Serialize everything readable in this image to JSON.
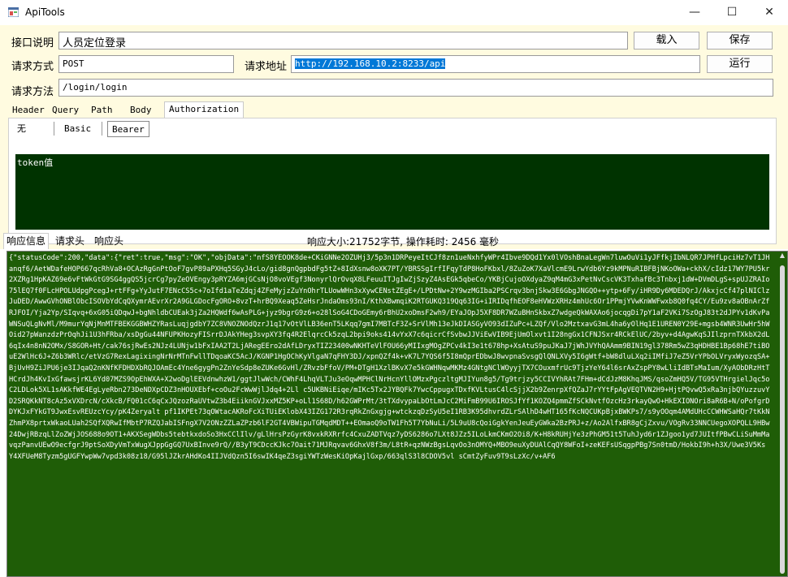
{
  "window": {
    "title": "ApiTools",
    "minimize": "—",
    "maximize": "☐",
    "close": "✕"
  },
  "form": {
    "desc_label": "接口说明",
    "desc_value": "人员定位登录",
    "method_label": "请求方式",
    "method_value": "POST",
    "url_label": "请求地址",
    "url_value": "http://192.168.10.2:8233/api",
    "path_label": "请求方法",
    "path_value": "/login/login",
    "load_button": "载入",
    "save_button": "保存",
    "run_button": "运行"
  },
  "request_tabs": [
    "Header",
    "Query",
    "Path",
    "Body",
    "Authorization"
  ],
  "auth_tabs": [
    "无",
    "Basic",
    "Bearer"
  ],
  "token_value": "token值",
  "response": {
    "tabs": [
      "响应信息",
      "请求头",
      "响应头"
    ],
    "info": "响应大小:21752字节, 操作耗时: 2456 毫秒",
    "body": "{\"statusCode\":200,\"data\":{\"ret\":true,\"msg\":\"OK\",\"objData\":\"nfS8YEOOK8de+CKiGNNe2OZUHj3/5p3n1DRPeyeItCJf8zn1ueNxhfyWPr4Ibve9DQd1Yx0lVOshBnaLegWn7luwOuVi1yJFfkjIbNLQR7JPHfLpciHz7vT1JHanqf6/AetWDafeHOP667qcRhVa8+OCAzRgGnPtOoF7gvP89aPXHq5SGyJ4cLo/gid8gnQgpbdFg5tZ+8IdXsnw8oXK7PT/YBRSSgIrfIFqyTdP8HoFKbxl/8ZuZoK7XaVlcmE9LrwYdb6Yz9kMPNuRIBFBjNKoOWa+ckhX/cIdz17WY7PU5kr2XZRg1HpKAZ69e6vFtWkGtG9SG4ggQS5jcrCg7pyZeOVEngy3pRYZA6mjGCsNjO8voVEgf3NonyrlQrOvqX8LFeuuITJgIwZjSzyZ4AsEGk5qbeCo/YKBjCujoOXdyaZ9qM4mG3xPetNvCscVK3TxhafBc3Tnbxj1dW+DVmDLgS+spUJZRAIo75lEQ7f0FLcHPOLUdpgPcegJ+rtFFg+YyJutF7ENcCS5c+7oIfd1aTeZdqj4ZFeMyjzZuYnOhrTLUowWHn3xXywCENstZEgE+/LPDtNw+2Y9wzMGIba2PSCrqv3bnjSkw3E6GbgJNGQO++ytp+6Fy/iHR9Dy6MDEDQrJ/AkxjcCf47plNIClzJuDED/AwwGVhONBlObcISOVbYdCqQXymrAEvrXr2A9GLGDocFgORO+8vzT+hrBQ9Xeaq5ZeHsrJndaOms93nI/KthXBwmqiK2RTGUKQ319Qq63IG+iIRIDqfhEOF8eHVWzXRHz4mhUc6Or1PPmjYVwKnWWFwxb8Q0fq4CY/Eu9zv8aOBnArZfRJFOI/Yja2Yp/SIqvq+6xG05iQDqwJ+bgNhldbCUEak3jZa2HQWdf6wAsPLG+jyz9bgrG9z6+o28lSoG4CDoGEmy6rBhU2xoDmsF2wh9/EYaJOpJ5XF8DR7WZuBHnSkbxZ7wdgeQkWAXAo6jocqgDi7pY1aF2VKi7SzOgJ83t2dJPYv1dKvPaWNSuQLgNvMl/M9murYqNjMnMTFBEKGGBWHZYRasLuqjgdbY7ZC8VNOZNOdQzrJ1q17vOtVlLB36enT5LKqq7gmI7MBTcF3Z+SrVlMh13eJkDIASGyVO93dIZuPc+LZQf/Vlo2MztxavG3mL4ha6yOlHq1E1UREN0Y29E+mgsb4WNR3UwHr5hWOid27pWanzdzPrOqhJi1U3hFRba/xsDgGu44NFUPKHozyFISrrDJAkYHeg3svpXY3fq4R2ElqrcCk5zqL2bpi9oks414vYxX7c6qicrCfSvbwJJViEwVIB9EjUmOlxvt1I28ngGx1CFNJSxr4RCkElUC/2byv+d4AgwKqSJIlzprnTXkbX2dL6qIx4n8nN2OMx/S8GOR+Ht/cak76sjRwEs2NJz4LUNjw1bFxIAA2T2LjARegEEro2dAfLDryxTIZ23400wNKHTeVlFOU66yMIIxgMOgZPCv4kI3e1t678hp+XsAtuS9puJKaJ7jWhJVYhQAAmm9BIN19gl378Rm5wZ3qHDHBE1Bp68hE7tiBOuE2WlHc6J+Z6b3WRlc/etVzG7RexLagixingNrNrMTnFwllTDqoaKC5AcJ/KGNP1HgOChKyVlgaN7qFHY3DJ/xpnQZf4k+vK7L7YQS6f5I8mQprEDbwJ8wvpnaSvsgQlQNLXVy5I6gWtf+bW8dluLXq2iIMfiJ7eZ5VrYPbOLVryxWyozqSA+BjUvH9ZiJPU6je3IJqaQ2nKNfKFDHDXbRQJOAmEc4Yne6gygPn2ZnYeSdp8eZUKe6GvHl/ZRvzbFfoV/PM+DTgH1XzlBKvX7e5kGWHNqwMKMz4GNtgNClWOyyjTX7COuxmfrUc9TjzYeY64l6srAxZspPY8wLliIdBTsMaIum/XyAObDRzHtTHCrdJh4KvIxGfawsjrKL6Yd07MZS9OpEhWXA+X2woDglEEVdnwhzW1/ggtJlwWch/CWhF4LhqVLTJu3eOqwMPHClNrHcnYllOMzxPgczltgMJIYun8g5/Tg9trjzy5CCIVYhRAt7FHm+dCdJzM8KhqJMS/qsoZmHQ5V/TG95VTHrgielJqc5oC2LDLok5XL1sAKkfWE4EgLyeRbn273DeNDXpCDZ3nHOUXEbf+coOu2FcWwWjlJdq4+2Ll c5UKBNiEiqe/mIKc5Tx2JYBQFk7YwcCppugxTDxfKVLtusC4lcSjjX2b9ZenrpXfQZaJ7rYYtFpAgVEQTVN2H9+HjtPQvwQ5xRa3njbQYuzzuvYD2SRQKkNT8cAz5xVXDrcN/cXkcB/FQ01cC6qCxJQzozRaUVtwZ3b4EiiknGVJxxMZ5KP+oLl1S68D/h62GWPrMt/3tTXdvypaLbOtLmJcC2MiFmB99U6IROSJfYf1KOZQ4pmmZfSCkNvtfOzcHz3rkayQwO+HkEXIONOri8aR6B+N/oPofgrDDYKJxFYkGT9JwxEsvREUzcYcy/pK4Zeryalt pf1IKPEt73qOWtacAKRoFcXiTUiEKlobX43IZG172R3rqRkZnGxgjg+wtckzqDzSyU5eI1RB3K95dhvrdZLrSAlhD4wHT165fKcNQCUKpBjxBWKPs7/s9yOOqm4AMdUHcCCWHWSaHQr7tKkNZhmPX8prtxWkaoLUah2SQfXQRwIfMbtP7RZQJabISFngX7V2ONzZZLaZPzb6lF2GT4VBWipuTGMqdMDT++EOmaoQ9oTW1Fh5T7YbNuLi/5L9uU8cQoiGgkYenJeuEyGWka2BzPRJ+z/Ao2AlfxBR8gCjZxvu/VOgRv33NNCUegoXOPQLL9HBw24DwjRBzqLlZoZWjJOS688o9OT1+AKXSegWDbs5tebtkxdoSo3HxCClIlv/gLlHrsPzGyrK8vxkRXRrfc4CxuZADTVqz7yDS6286o7LXt8JZz5ILoLkmCKmO2Oi8/K+H8kRUHjYe3zPhGM51t5TuhJyd6r1ZJgoo1yd7JUItfPBwCLiSuMmMavqzPanvUEwO9ecfgrJ9ptSoXDyVmTxWugXJppGgGQ7UxBInve9rQ//B3yT9CDccKJkc7Oait71MJRqvav6GhxV8f3m/L8tR+qzNWzBgsLqvOo3nOMYQ+MBO9euXyDUAlCqQY8WFoI+zeKEFsUSqgpPBg7Sn0tmD/HokbI9h+h3X/Uwe3V5Ks Y4XFUeM8Tyzm5gUGFYwpWw7vpd3k08z18/G95lJZkrAHdKo4IIJVdQzn5I6swIK4qeZ3sgiYWTzWesKiOpKajlGxp/663qlS3l8CDOV5vl sCmtZyFuv9T9sLzXc/v+AF6"
  }
}
